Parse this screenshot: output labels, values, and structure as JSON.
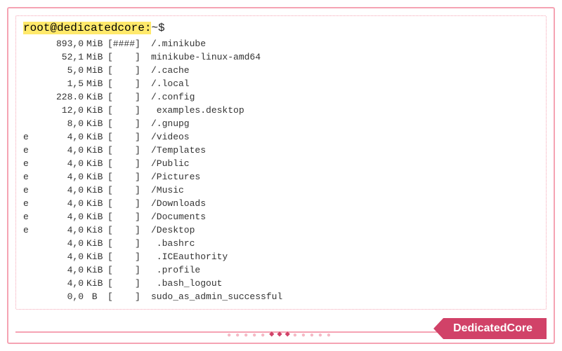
{
  "prompt": {
    "highlighted": "root@dedicatedcore:",
    "rest": "~$"
  },
  "listing": [
    {
      "flag": "",
      "size": "893,0",
      "unit": "MiB",
      "bar": "[####]",
      "name": "/.minikube"
    },
    {
      "flag": "",
      "size": "52,1",
      "unit": "MiB",
      "bar": "[    ]",
      "name": "minikube-linux-amd64"
    },
    {
      "flag": "",
      "size": "5,0",
      "unit": "MiB",
      "bar": "[    ]",
      "name": "/.cache"
    },
    {
      "flag": "",
      "size": "1,5",
      "unit": "MiB",
      "bar": "[    ]",
      "name": "/.local"
    },
    {
      "flag": "",
      "size": "228.0",
      "unit": "KiB",
      "bar": "[    ]",
      "name": "/.config"
    },
    {
      "flag": "",
      "size": "12,0",
      "unit": "KiB",
      "bar": "[    ]",
      "name": " examples.desktop"
    },
    {
      "flag": "",
      "size": "8,0",
      "unit": "KiB",
      "bar": "[    ]",
      "name": "/.gnupg"
    },
    {
      "flag": "e",
      "size": "4,0",
      "unit": "KiB",
      "bar": "[    ]",
      "name": "/videos"
    },
    {
      "flag": "e",
      "size": "4,0",
      "unit": "KiB",
      "bar": "[    ]",
      "name": "/Templates"
    },
    {
      "flag": "e",
      "size": "4,0",
      "unit": "KiB",
      "bar": "[    ]",
      "name": "/Public"
    },
    {
      "flag": "e",
      "size": "4,0",
      "unit": "KiB",
      "bar": "[    ]",
      "name": "/Pictures"
    },
    {
      "flag": "e",
      "size": "4,0",
      "unit": "KiB",
      "bar": "[    ]",
      "name": "/Music"
    },
    {
      "flag": "e",
      "size": "4,0",
      "unit": "KiB",
      "bar": "[    ]",
      "name": "/Downloads"
    },
    {
      "flag": "e",
      "size": "4,0",
      "unit": "KiB",
      "bar": "[    ]",
      "name": "/Documents"
    },
    {
      "flag": "e",
      "size": "4,0",
      "unit": "Ki8",
      "bar": "[    ]",
      "name": "/Desktop"
    },
    {
      "flag": "",
      "size": "4,0",
      "unit": "KiB",
      "bar": "[    ]",
      "name": " .bashrc"
    },
    {
      "flag": "",
      "size": "4,0",
      "unit": "KiB",
      "bar": "[    ]",
      "name": " .ICEauthority"
    },
    {
      "flag": "",
      "size": "4,0",
      "unit": "KiB",
      "bar": "[    ]",
      "name": " .profile"
    },
    {
      "flag": "",
      "size": "4,0",
      "unit": "KiB",
      "bar": "[    ]",
      "name": " .bash_logout"
    },
    {
      "flag": "",
      "size": "0,0",
      "unit": " B ",
      "bar": "[    ]",
      "name": "sudo_as_admin_successful"
    }
  ],
  "brand": "DedicatedCore"
}
